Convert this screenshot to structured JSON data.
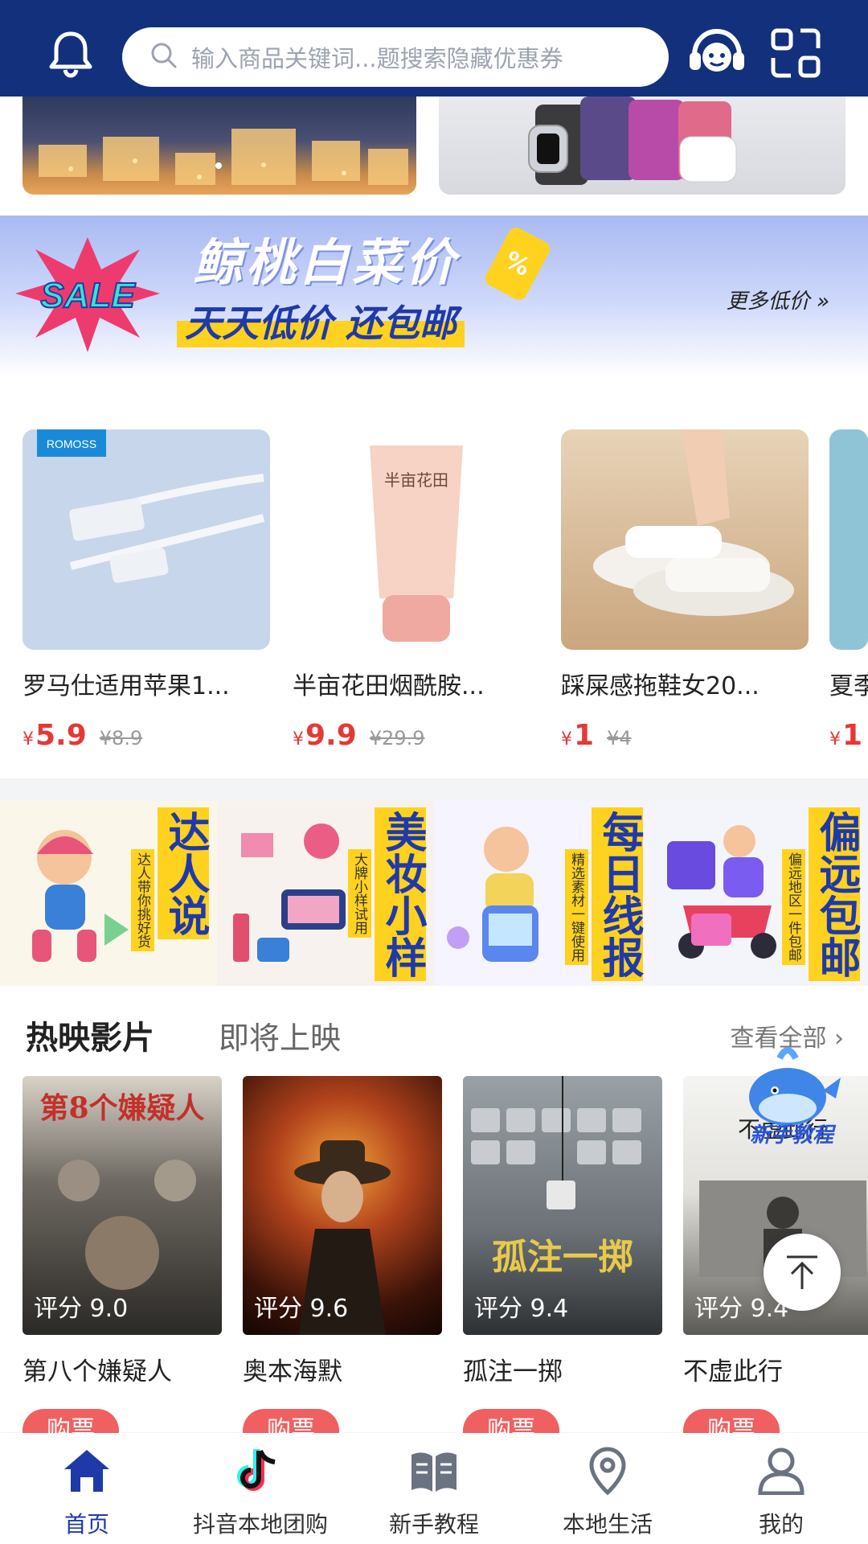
{
  "header": {
    "search_placeholder": "输入商品关键词...题搜索隐藏优惠券",
    "icons": [
      "bell-icon",
      "search-icon",
      "customer-service-icon",
      "scan-icon"
    ]
  },
  "promo": {
    "title": "鲸桃白菜价",
    "subtitle": "天天低价 还包邮",
    "more_label": "更多低价",
    "sale_badge": "SALE",
    "tag_symbol": "%"
  },
  "products": [
    {
      "name": "罗马仕适用苹果1...",
      "currency": "¥",
      "price": "5.9",
      "original": "¥8.9",
      "brand": "ROMOSS"
    },
    {
      "name": "半亩花田烟酰胺...",
      "currency": "¥",
      "price": "9.9",
      "original": "¥29.9",
      "brand": "半亩花田"
    },
    {
      "name": "踩屎感拖鞋女20...",
      "currency": "¥",
      "price": "1",
      "original": "¥4"
    },
    {
      "name": "夏季",
      "currency": "¥",
      "price": "1",
      "original": ""
    }
  ],
  "categories": [
    {
      "title": "达人说",
      "subtitle": "达人带你挑好货"
    },
    {
      "title": "美妆小样",
      "subtitle": "大牌小样试用"
    },
    {
      "title": "每日线报",
      "subtitle": "精选素材一键使用"
    },
    {
      "title": "偏远包邮",
      "subtitle": "偏远地区一件包邮"
    }
  ],
  "movies": {
    "tab_now": "热映影片",
    "tab_soon": "即将上映",
    "see_all": "查看全部 ›",
    "buy_label": "购票",
    "items": [
      {
        "title": "第八个嫌疑人",
        "rating": "评分 9.0",
        "poster_text": "第8个嫌疑人"
      },
      {
        "title": "奥本海默",
        "rating": "评分 9.6",
        "poster_text": ""
      },
      {
        "title": "孤注一掷",
        "rating": "评分 9.4",
        "poster_text": "孤注一掷"
      },
      {
        "title": "不虚此行",
        "rating": "评分 9.4",
        "poster_text": "不虚此行"
      }
    ]
  },
  "floating": {
    "tutorial_label": "新手教程"
  },
  "nav": [
    {
      "label": "首页",
      "icon": "home-icon",
      "active": true
    },
    {
      "label": "抖音本地团购",
      "icon": "tiktok-icon",
      "active": false
    },
    {
      "label": "新手教程",
      "icon": "book-icon",
      "active": false
    },
    {
      "label": "本地生活",
      "icon": "location-icon",
      "active": false
    },
    {
      "label": "我的",
      "icon": "user-icon",
      "active": false
    }
  ],
  "colors": {
    "header_bg": "#13307c",
    "accent_red": "#e53935",
    "accent_yellow": "#ffd21f",
    "nav_active": "#1f3aa8"
  }
}
